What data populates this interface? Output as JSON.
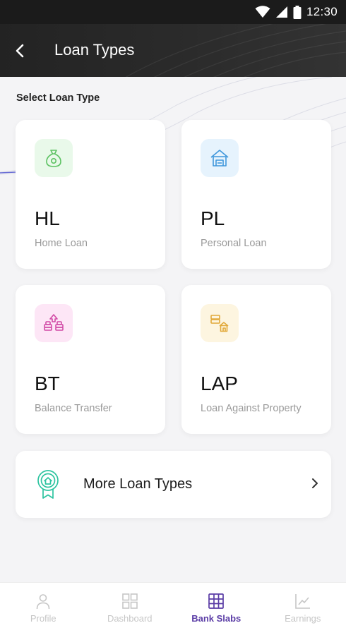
{
  "status_bar": {
    "time": "12:30"
  },
  "header": {
    "title": "Loan Types"
  },
  "section": {
    "label": "Select Loan Type"
  },
  "loan_types": [
    {
      "code": "HL",
      "name": "Home Loan",
      "icon": "money-bag-icon",
      "icon_bg": "#e9f9ea",
      "icon_color": "#5cc262"
    },
    {
      "code": "PL",
      "name": "Personal Loan",
      "icon": "house-icon",
      "icon_bg": "#e6f3fd",
      "icon_color": "#3f97dc"
    },
    {
      "code": "BT",
      "name": "Balance Transfer",
      "icon": "transfer-icon",
      "icon_bg": "#fde6f6",
      "icon_color": "#d24aa6"
    },
    {
      "code": "LAP",
      "name": "Loan Against Property",
      "icon": "property-icon",
      "icon_bg": "#fdf5e0",
      "icon_color": "#e2a93a"
    }
  ],
  "more": {
    "label": "More Loan Types",
    "icon": "badge-house-icon",
    "icon_color": "#2ec4a0"
  },
  "bottom_nav": [
    {
      "label": "Profile",
      "icon": "person-icon",
      "active": false
    },
    {
      "label": "Dashboard",
      "icon": "grid-icon",
      "active": false
    },
    {
      "label": "Bank Slabs",
      "icon": "table-icon",
      "active": true
    },
    {
      "label": "Earnings",
      "icon": "chart-icon",
      "active": false
    }
  ],
  "colors": {
    "accent": "#5b3da6",
    "header_bg": "#252525",
    "page_bg": "#f4f4f6"
  }
}
